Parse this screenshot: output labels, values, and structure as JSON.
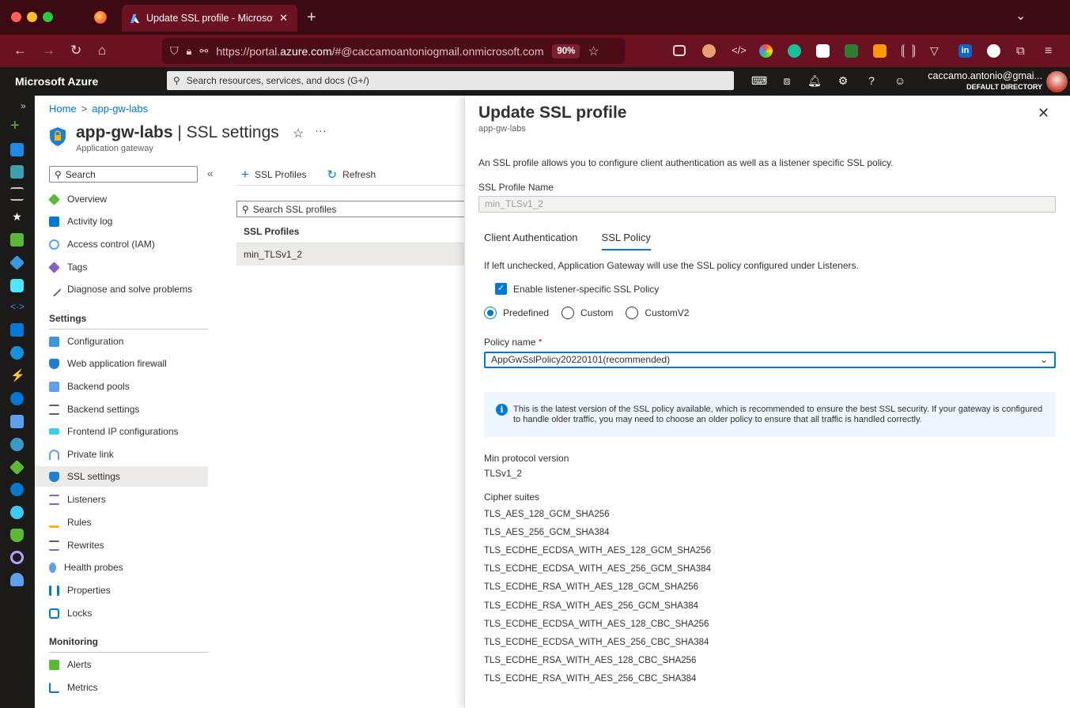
{
  "browser": {
    "tab_title": "Update SSL profile - Microsoft Azure",
    "url_prefix": "https://portal.",
    "url_domain": "azure.com",
    "url_suffix": "/#@caccamoantoniogmail.onmicrosoft.com",
    "zoom": "90%"
  },
  "azure": {
    "brand": "Microsoft Azure",
    "search_placeholder": "Search resources, services, and docs (G+/)",
    "account_name": "caccamo.antonio@gmai...",
    "account_dir": "DEFAULT DIRECTORY"
  },
  "breadcrumb": {
    "home": "Home",
    "resource": "app-gw-labs"
  },
  "resource": {
    "name": "app-gw-labs",
    "section": "SSL settings",
    "type": "Application gateway"
  },
  "sidebar": {
    "search_placeholder": "Search",
    "items": [
      {
        "label": "Overview"
      },
      {
        "label": "Activity log"
      },
      {
        "label": "Access control (IAM)"
      },
      {
        "label": "Tags"
      },
      {
        "label": "Diagnose and solve problems"
      }
    ],
    "settings_title": "Settings",
    "settings": [
      {
        "label": "Configuration"
      },
      {
        "label": "Web application firewall"
      },
      {
        "label": "Backend pools"
      },
      {
        "label": "Backend settings"
      },
      {
        "label": "Frontend IP configurations"
      },
      {
        "label": "Private link"
      },
      {
        "label": "SSL settings"
      },
      {
        "label": "Listeners"
      },
      {
        "label": "Rules"
      },
      {
        "label": "Rewrites"
      },
      {
        "label": "Health probes"
      },
      {
        "label": "Properties"
      },
      {
        "label": "Locks"
      }
    ],
    "monitoring_title": "Monitoring",
    "monitoring": [
      {
        "label": "Alerts"
      },
      {
        "label": "Metrics"
      }
    ]
  },
  "toolbar": {
    "ssl_profiles": "SSL Profiles",
    "refresh": "Refresh"
  },
  "profiles": {
    "search_placeholder": "Search SSL profiles",
    "header": "SSL Profiles",
    "rows": [
      "min_TLSv1_2"
    ]
  },
  "blade": {
    "title": "Update SSL profile",
    "subtitle": "app-gw-labs",
    "description": "An SSL profile allows you to configure client authentication as well as a listener specific SSL policy.",
    "name_label": "SSL Profile Name",
    "name_value": "min_TLSv1_2",
    "tab_client_auth": "Client Authentication",
    "tab_ssl_policy": "SSL Policy",
    "unchecked_note": "If left unchecked, Application Gateway will use the SSL policy configured under Listeners.",
    "enable_label": "Enable listener-specific SSL Policy",
    "radio_predefined": "Predefined",
    "radio_custom": "Custom",
    "radio_customv2": "CustomV2",
    "policy_label": "Policy name",
    "policy_required": "*",
    "policy_value": "AppGwSslPolicy20220101(recommended)",
    "info_text": "This is the latest version of the SSL policy available, which is recommended to ensure the best SSL security. If your gateway is configured to handle older traffic, you may need to choose an older policy to ensure that all traffic is handled correctly.",
    "min_protocol_label": "Min protocol version",
    "min_protocol_value": "TLSv1_2",
    "cipher_label": "Cipher suites",
    "ciphers": [
      "TLS_AES_128_GCM_SHA256",
      "TLS_AES_256_GCM_SHA384",
      "TLS_ECDHE_ECDSA_WITH_AES_128_GCM_SHA256",
      "TLS_ECDHE_ECDSA_WITH_AES_256_GCM_SHA384",
      "TLS_ECDHE_RSA_WITH_AES_128_GCM_SHA256",
      "TLS_ECDHE_RSA_WITH_AES_256_GCM_SHA384",
      "TLS_ECDHE_ECDSA_WITH_AES_128_CBC_SHA256",
      "TLS_ECDHE_ECDSA_WITH_AES_256_CBC_SHA384",
      "TLS_ECDHE_RSA_WITH_AES_128_CBC_SHA256",
      "TLS_ECDHE_RSA_WITH_AES_256_CBC_SHA384"
    ]
  },
  "colors": {
    "accent": "#0078d4",
    "browser_bg": "#3b0a12",
    "browser_nav": "#6b1222",
    "azure_header": "#1b1a19"
  }
}
